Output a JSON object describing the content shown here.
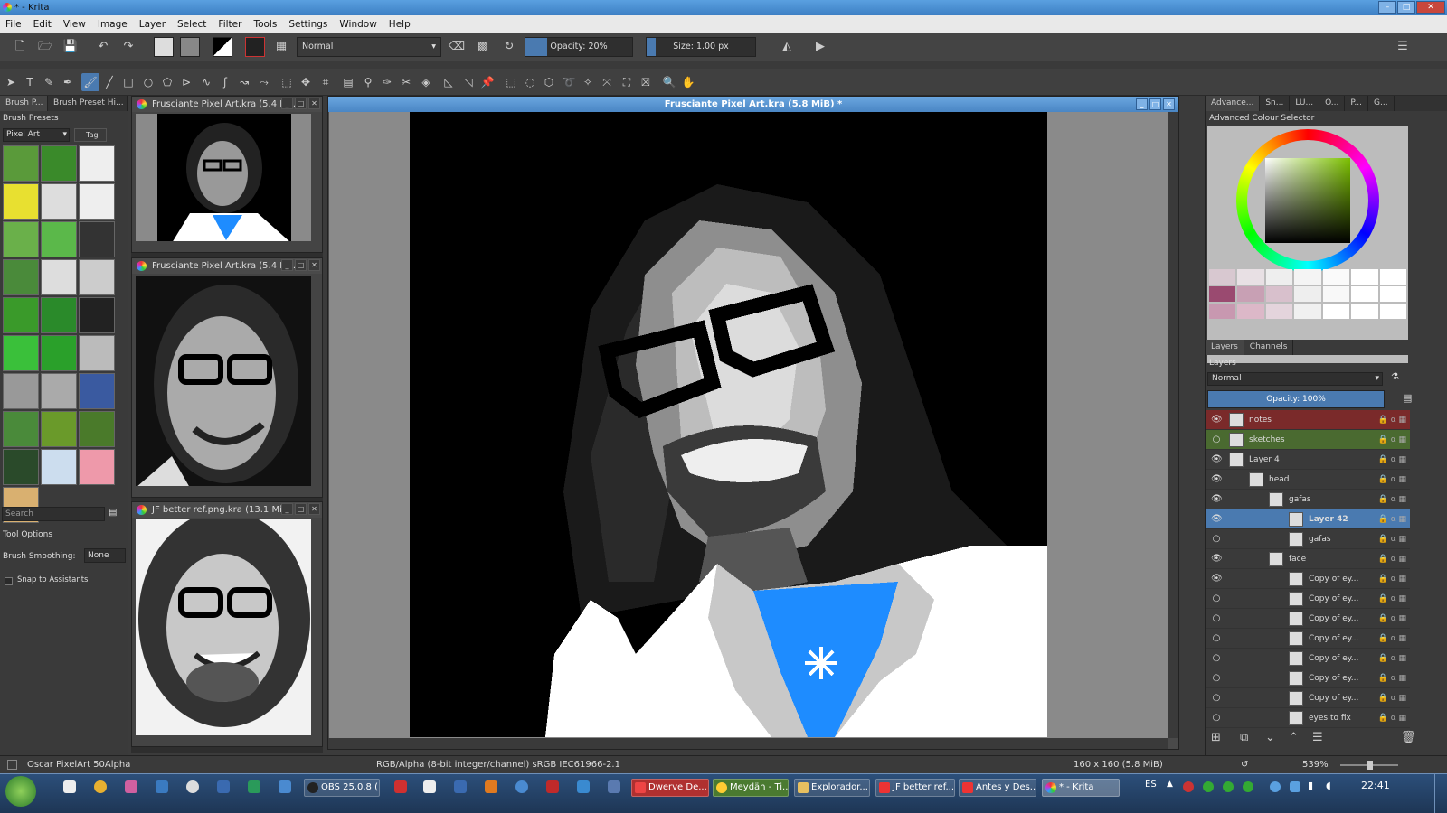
{
  "window": {
    "title": "* - Krita"
  },
  "menu": [
    "File",
    "Edit",
    "View",
    "Image",
    "Layer",
    "Select",
    "Filter",
    "Tools",
    "Settings",
    "Window",
    "Help"
  ],
  "toolbar": {
    "blend_mode": "Normal",
    "opacity_label": "Opacity: 20%",
    "opacity_value": 0.2,
    "size_label": "Size: 1.00 px"
  },
  "left_dock": {
    "tabs": [
      "Brush P...",
      "Brush Preset Hi..."
    ],
    "title": "Brush Presets",
    "filter": "Pixel Art",
    "tag_label": "Tag",
    "search_placeholder": "Search",
    "tool_options_title": "Tool Options",
    "smoothing_label": "Brush Smoothing:",
    "smoothing_value": "None",
    "snap_label": "Snap to Assistants"
  },
  "subwindows": [
    {
      "title": "Frusciante Pixel Art.kra (5.4 Mi..."
    },
    {
      "title": "Frusciante Pixel Art.kra (5.4 Mi..."
    },
    {
      "title": "JF better ref.png.kra (13.1 MiB)"
    }
  ],
  "main_window": {
    "title": "Frusciante Pixel Art.kra (5.8 MiB) *"
  },
  "right_dock": {
    "tabs": [
      "Advance...",
      "Sn...",
      "LU...",
      "O...",
      "P...",
      "G..."
    ],
    "color_selector_title": "Advanced Colour Selector",
    "layer_tabs": [
      "Layers",
      "Channels"
    ],
    "layers_title": "Layers",
    "blend_mode": "Normal",
    "opacity_label": "Opacity:  100%",
    "layers": [
      {
        "name": "notes",
        "indent": 0,
        "visible": true,
        "color": "#7a2a2a"
      },
      {
        "name": "sketches",
        "indent": 0,
        "visible": false,
        "color": "#4a6a30"
      },
      {
        "name": "Layer 4",
        "indent": 0,
        "visible": true,
        "color": ""
      },
      {
        "name": "head",
        "indent": 1,
        "visible": true,
        "color": ""
      },
      {
        "name": "gafas",
        "indent": 2,
        "visible": true,
        "color": ""
      },
      {
        "name": "Layer 42",
        "indent": 3,
        "visible": true,
        "color": "#4a7ab0"
      },
      {
        "name": "gafas",
        "indent": 3,
        "visible": false,
        "color": ""
      },
      {
        "name": "face",
        "indent": 2,
        "visible": true,
        "color": ""
      },
      {
        "name": "Copy of ey...",
        "indent": 3,
        "visible": true,
        "color": ""
      },
      {
        "name": "Copy of ey...",
        "indent": 3,
        "visible": false,
        "color": ""
      },
      {
        "name": "Copy of ey...",
        "indent": 3,
        "visible": false,
        "color": ""
      },
      {
        "name": "Copy of ey...",
        "indent": 3,
        "visible": false,
        "color": ""
      },
      {
        "name": "Copy of ey...",
        "indent": 3,
        "visible": false,
        "color": ""
      },
      {
        "name": "Copy of ey...",
        "indent": 3,
        "visible": false,
        "color": ""
      },
      {
        "name": "Copy of ey...",
        "indent": 3,
        "visible": false,
        "color": ""
      },
      {
        "name": "eyes to fix",
        "indent": 3,
        "visible": false,
        "color": ""
      }
    ]
  },
  "statusbar": {
    "brush": "Oscar PixelArt 50Alpha",
    "color_info": "RGB/Alpha (8-bit integer/channel)  sRGB IEC61966-2.1",
    "image_info": "160 x 160 (5.8 MiB)",
    "zoom": "539%"
  },
  "taskbar": {
    "tasks": [
      "OBS 25.0.8 (...",
      "Dwerve De...",
      "Meydän - Ti...",
      "Explorador...",
      "JF better ref...",
      "Antes y Des...",
      "* - Krita"
    ],
    "lang": "ES",
    "clock": "22:41"
  },
  "colors": {
    "accent": "#4a7ab0",
    "shirt_blue": "#1e8cff"
  }
}
